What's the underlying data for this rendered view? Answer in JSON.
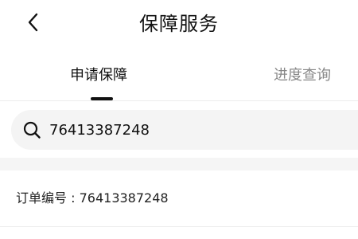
{
  "header": {
    "title": "保障服务",
    "back_icon": "chevron-left-icon"
  },
  "tabs": [
    {
      "label": "申请保障",
      "active": true
    },
    {
      "label": "进度查询",
      "active": false
    }
  ],
  "search": {
    "icon": "search-icon",
    "value": "76413387248",
    "placeholder": ""
  },
  "order": {
    "label": "订单编号",
    "separator": ":",
    "number": "76413387248"
  },
  "colors": {
    "text_primary": "#111111",
    "text_secondary": "#888888",
    "search_bg": "#f4f4f4",
    "band_bg": "#f5f5f5"
  }
}
